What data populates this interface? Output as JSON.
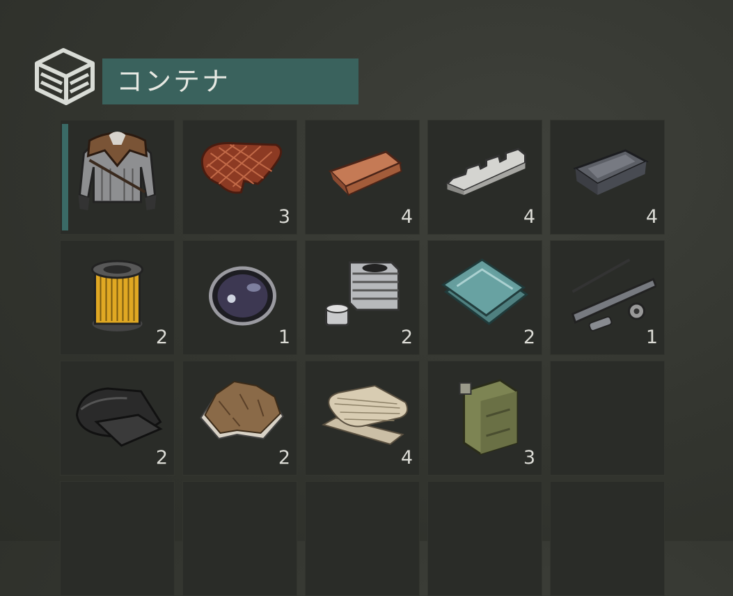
{
  "header": {
    "title": "コンテナ",
    "icon": "container-box-icon"
  },
  "slots": [
    {
      "item": "armor-jacket-icon",
      "count": ""
    },
    {
      "item": "meat-steak-icon",
      "count": "3"
    },
    {
      "item": "copper-ingot-icon",
      "count": "4"
    },
    {
      "item": "aluminum-bar-icon",
      "count": "4"
    },
    {
      "item": "iron-ingot-icon",
      "count": "4"
    },
    {
      "item": "air-filter-icon",
      "count": "2"
    },
    {
      "item": "lens-icon",
      "count": "1"
    },
    {
      "item": "engine-cylinder-icon",
      "count": "2"
    },
    {
      "item": "glass-sheets-icon",
      "count": "2"
    },
    {
      "item": "gun-parts-icon",
      "count": "1"
    },
    {
      "item": "rubber-sheet-icon",
      "count": "2"
    },
    {
      "item": "fur-pelt-icon",
      "count": "2"
    },
    {
      "item": "cloth-roll-icon",
      "count": "4"
    },
    {
      "item": "jerry-can-icon",
      "count": "3"
    },
    {
      "item": "",
      "count": ""
    },
    {
      "item": "",
      "count": ""
    },
    {
      "item": "",
      "count": ""
    },
    {
      "item": "",
      "count": ""
    },
    {
      "item": "",
      "count": ""
    },
    {
      "item": "",
      "count": ""
    }
  ]
}
